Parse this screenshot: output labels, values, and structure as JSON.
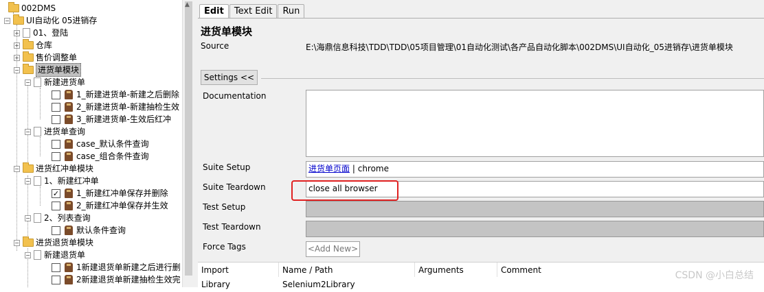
{
  "tree": {
    "root": "002DMS",
    "project": "UI自动化 05进销存",
    "items": [
      "01、登陆",
      "仓库",
      "售价调整单",
      "进货单模块",
      "新建进货单",
      "1_新建进货单-新建之后删除",
      "2_新建进货单-新建抽检生效",
      "3_新建进货单-生效后红冲",
      "进货单查询",
      "case_默认条件查询",
      "case_组合条件查询",
      "进货红冲单模块",
      "1、新建红冲单",
      "1_新建红冲单保存并删除",
      "2_新建红冲单保存并生效",
      "2、列表查询",
      "默认条件查询",
      "进货退货单模块",
      "新建退货单",
      "1新建退货单新建之后进行删",
      "2新建退货单新建抽检生效完"
    ]
  },
  "tabs": [
    "Edit",
    "Text Edit",
    "Run"
  ],
  "page": {
    "title": "进货单模块",
    "source_label": "Source",
    "source_path": "E:\\海鼎信息科技\\TDD\\TDD\\05项目管理\\01自动化测试\\各产品自动化脚本\\002DMS\\UI自动化_05进销存\\进货单模块",
    "settings_button": "Settings <<",
    "documentation_label": "Documentation",
    "suite_setup_label": "Suite Setup",
    "suite_setup_link": "进货单页面",
    "suite_setup_sep": "|",
    "suite_setup_arg": "chrome",
    "suite_teardown_label": "Suite Teardown",
    "suite_teardown_value": "close all browser",
    "test_setup_label": "Test Setup",
    "test_teardown_label": "Test Teardown",
    "force_tags_label": "Force Tags",
    "add_new": "<Add New>"
  },
  "imports": {
    "headers": [
      "Import",
      "Name / Path",
      "Arguments",
      "Comment"
    ],
    "rows": [
      [
        "Library",
        "Selenium2Library",
        "",
        ""
      ]
    ]
  },
  "watermark": "CSDN @小白总结"
}
